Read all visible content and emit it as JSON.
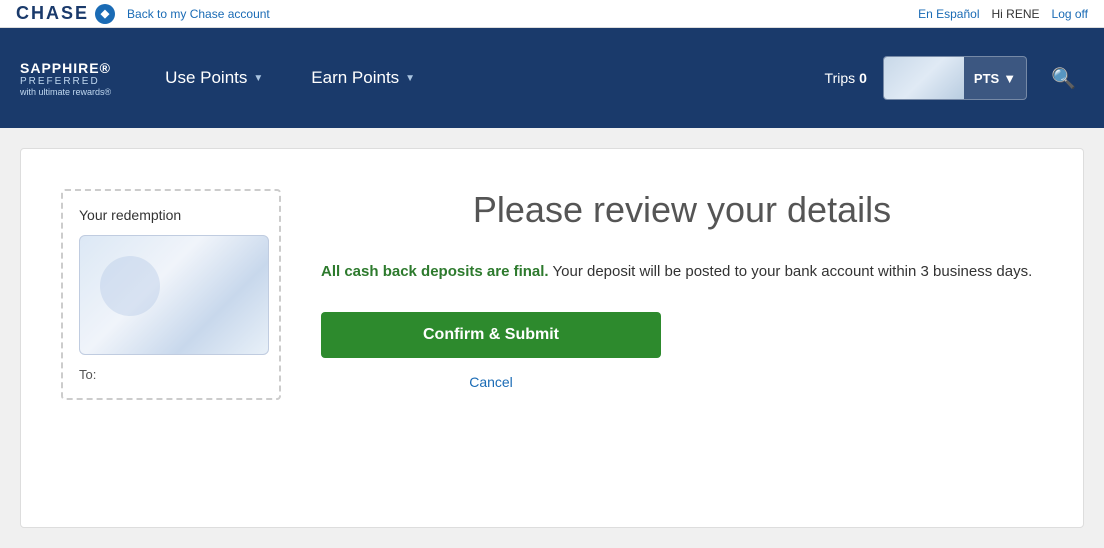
{
  "topbar": {
    "brand": "CHASE",
    "brand_icon": "◆",
    "back_link": "Back to my Chase account",
    "lang_link": "En Español",
    "greeting": "Hi RENE",
    "logoff": "Log off"
  },
  "navbar": {
    "logo_line1": "SAPPHIRE®",
    "logo_line2": "PREFERRED",
    "logo_line3": "with ultimate rewards®",
    "nav_items": [
      {
        "label": "Use Points",
        "arrow": "▼"
      },
      {
        "label": "Earn Points",
        "arrow": "▼"
      }
    ],
    "trips_label": "Trips",
    "trips_count": "0",
    "pts_label": "PTS",
    "pts_arrow": "▼"
  },
  "main": {
    "review_title": "Please review your details",
    "notice_bold": "All cash back deposits are final.",
    "notice_normal": " Your deposit will be posted to your bank account within 3 business days.",
    "confirm_button": "Confirm & Submit",
    "cancel_link": "Cancel",
    "redemption_title": "Your redemption",
    "to_label": "To:"
  }
}
